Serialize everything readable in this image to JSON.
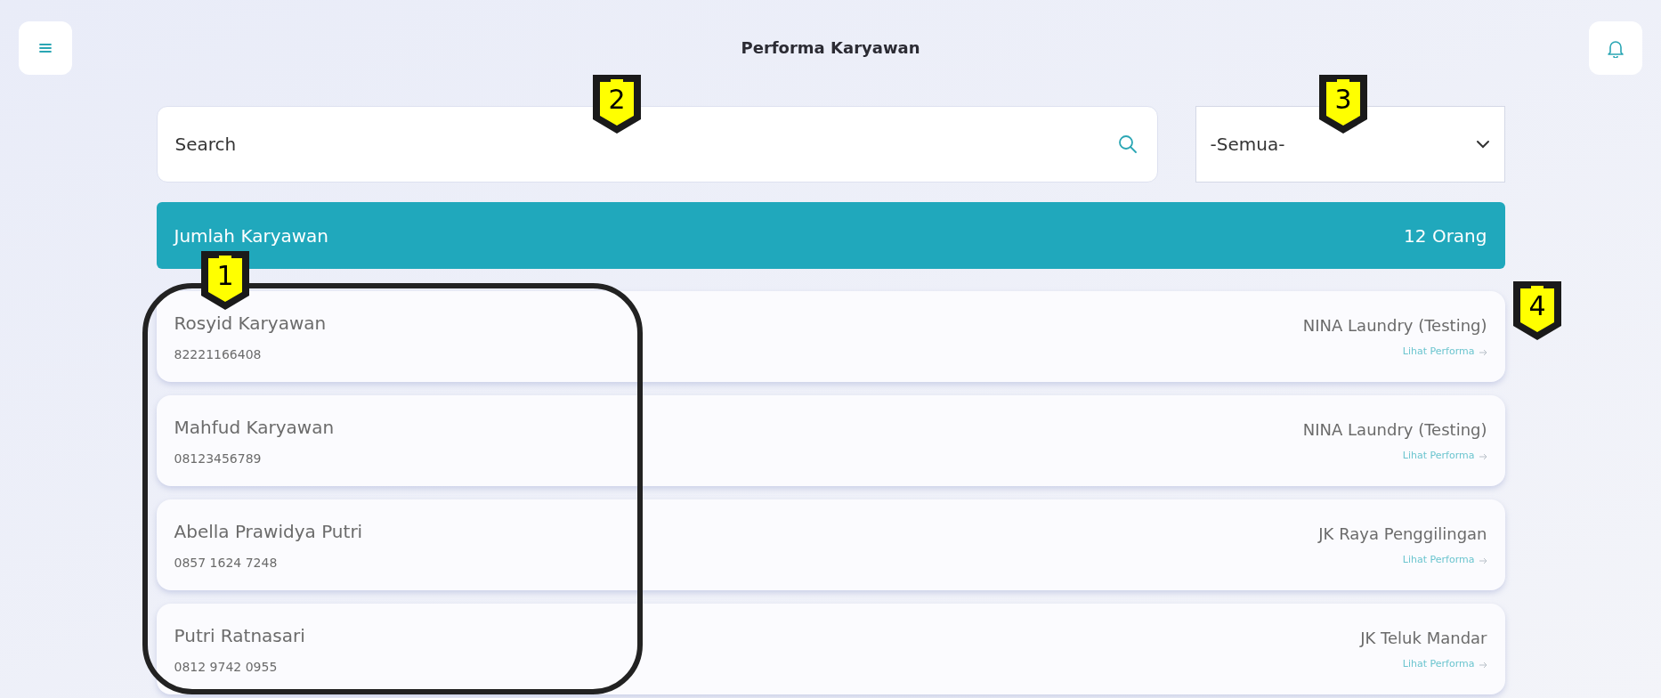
{
  "title": "Performa Karyawan",
  "search": {
    "placeholder": "Search"
  },
  "filter": {
    "value": "-Semua-"
  },
  "summary": {
    "label": "Jumlah Karyawan",
    "count": "12 Orang"
  },
  "employees": [
    {
      "name": "Rosyid Karyawan",
      "phone": "82221166408",
      "branch": "NINA Laundry (Testing)",
      "link": "Lihat Performa"
    },
    {
      "name": "Mahfud Karyawan",
      "phone": "08123456789",
      "branch": "NINA Laundry (Testing)",
      "link": "Lihat Performa"
    },
    {
      "name": "Abella Prawidya Putri",
      "phone": "0857 1624 7248",
      "branch": "JK Raya Penggilingan",
      "link": "Lihat Performa"
    },
    {
      "name": "Putri Ratnasari",
      "phone": "0812 9742 0955",
      "branch": "JK Teluk Mandar",
      "link": "Lihat Performa"
    }
  ],
  "callouts": [
    {
      "label": "1"
    },
    {
      "label": "2"
    },
    {
      "label": "3"
    },
    {
      "label": "4"
    }
  ]
}
